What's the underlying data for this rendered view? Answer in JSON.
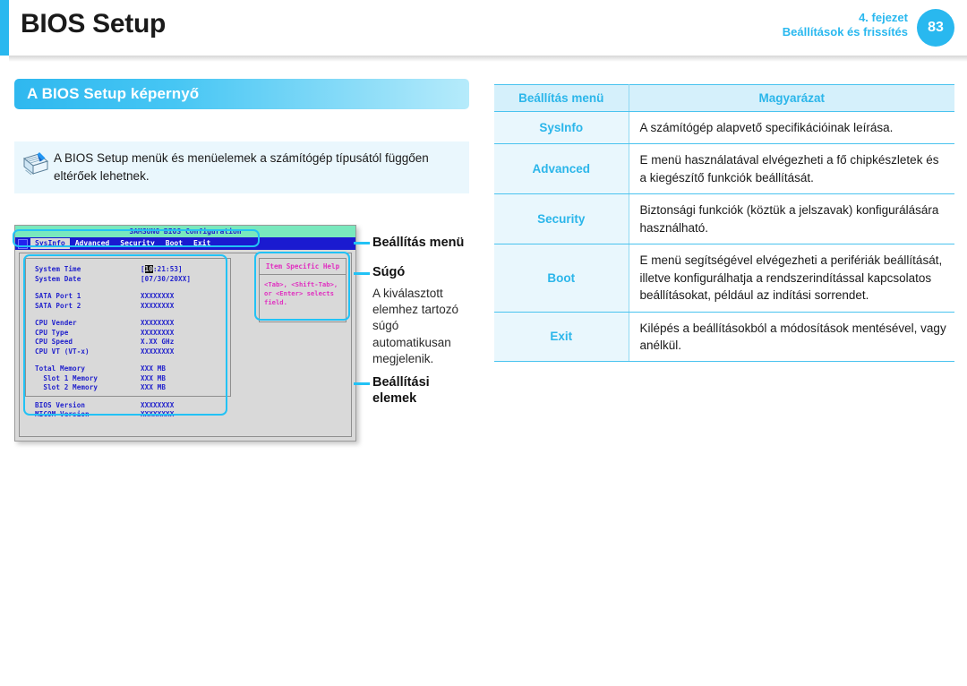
{
  "header": {
    "title": "BIOS Setup",
    "chapter": "4. fejezet",
    "chapter_name": "Beállítások és frissítés",
    "page_number": "83",
    "accent_color": "#29b8ef"
  },
  "section": {
    "title": "A BIOS Setup képernyő"
  },
  "note": {
    "icon": "note-pen-icon",
    "text": "A BIOS Setup menük és menüelemek a számítógép típusától függően eltérőek lehetnek."
  },
  "bios_mock": {
    "window_title": "SAMSUNG BIOS Configuration",
    "menu_items": [
      "SysInfo",
      "Advanced",
      "Security",
      "Boot",
      "Exit"
    ],
    "selected_menu": "SysInfo",
    "fields": [
      {
        "label": "System Time",
        "value": "[10:21:53]",
        "cursor": "10",
        "value_rest": ":21:53]",
        "value_prefix": "[",
        "gap": false
      },
      {
        "label": "System Date",
        "value": "[07/30/20XX]",
        "gap": false
      },
      {
        "label": "SATA Port 1",
        "value": "XXXXXXXX",
        "gap": true
      },
      {
        "label": "SATA Port 2",
        "value": "XXXXXXXX",
        "gap": false
      },
      {
        "label": "CPU Vender",
        "value": "XXXXXXXX",
        "gap": true
      },
      {
        "label": "CPU Type",
        "value": "XXXXXXXX",
        "gap": false
      },
      {
        "label": "CPU Speed",
        "value": "X.XX GHz",
        "gap": false
      },
      {
        "label": "CPU VT (VT-x)",
        "value": "XXXXXXXX",
        "gap": false
      },
      {
        "label": "Total Memory",
        "value": "XXX MB",
        "gap": true
      },
      {
        "label": "  Slot 1 Memory",
        "value": "XXX MB",
        "gap": false
      },
      {
        "label": "  Slot 2 Memory",
        "value": "XXX MB",
        "gap": false
      },
      {
        "label": "BIOS Version",
        "value": "XXXXXXXX",
        "gap": true
      },
      {
        "label": "MICOM Version",
        "value": "XXXXXXXX",
        "gap": false
      }
    ],
    "help_title": "Item Specific Help",
    "help_body": "<Tab>, <Shift-Tab>,\nor <Enter> selects\nfield.",
    "highlight_color": "#22c2f5"
  },
  "annotations": [
    {
      "title": "Beállítás menü",
      "body": ""
    },
    {
      "title": "Súgó",
      "body": "A kiválasztott elemhez tartozó súgó automatikusan megjelenik."
    },
    {
      "title": "Beállítási elemek",
      "body": ""
    }
  ],
  "table": {
    "headers": [
      "Beállítás menü",
      "Magyarázat"
    ],
    "rows": [
      {
        "menu": "SysInfo",
        "desc": "A számítógép alapvető specifikációinak leírása."
      },
      {
        "menu": "Advanced",
        "desc": "E menü használatával elvégezheti a fő chipkészletek és a kiegészítő funkciók beállítását."
      },
      {
        "menu": "Security",
        "desc": "Biztonsági funkciók (köztük a jelszavak) konfigurálására használható."
      },
      {
        "menu": "Boot",
        "desc": "E menü segítségével elvégezheti a perifériák beállítását, illetve konfigurálhatja a rendszerindítással kapcsolatos beállításokat, például az indítási sorrendet."
      },
      {
        "menu": "Exit",
        "desc": "Kilépés a beállításokból a módosítások mentésével, vagy anélkül."
      }
    ]
  }
}
